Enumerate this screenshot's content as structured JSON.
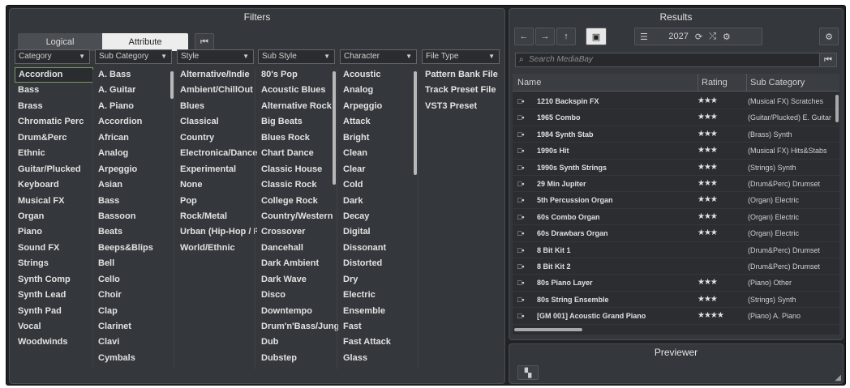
{
  "filters": {
    "title": "Filters",
    "mode_logical": "Logical",
    "mode_attribute": "Attribute",
    "reset_icon": "⏮",
    "columns": [
      {
        "header": "Category",
        "items": [
          "Accordion",
          "Bass",
          "Brass",
          "Chromatic Perc",
          "Drum&Perc",
          "Ethnic",
          "Guitar/Plucked",
          "Keyboard",
          "Musical FX",
          "Organ",
          "Piano",
          "Sound FX",
          "Strings",
          "Synth Comp",
          "Synth Lead",
          "Synth Pad",
          "Vocal",
          "Woodwinds"
        ]
      },
      {
        "header": "Sub Category",
        "items": [
          "A. Bass",
          "A. Guitar",
          "A. Piano",
          "Accordion",
          "African",
          "Analog",
          "Arpeggio",
          "Asian",
          "Bass",
          "Bassoon",
          "Beats",
          "Beeps&Blips",
          "Bell",
          "Cello",
          "Choir",
          "Clap",
          "Clarinet",
          "Clavi",
          "Cymbals"
        ]
      },
      {
        "header": "Style",
        "items": [
          "Alternative/Indie",
          "Ambient/ChillOut",
          "Blues",
          "Classical",
          "Country",
          "Electronica/Dance",
          "Experimental",
          "None",
          "Pop",
          "Rock/Metal",
          "Urban (Hip-Hop / R&B)",
          "World/Ethnic"
        ]
      },
      {
        "header": "Sub Style",
        "items": [
          "80's Pop",
          "Acoustic Blues",
          "Alternative Rock",
          "Big Beats",
          "Blues Rock",
          "Chart Dance",
          "Classic House",
          "Classic Rock",
          "College Rock",
          "Country/Western",
          "Crossover",
          "Dancehall",
          "Dark Ambient",
          "Dark Wave",
          "Disco",
          "Downtempo",
          "Drum'n'Bass/Jungle",
          "Dub",
          "Dubstep"
        ]
      },
      {
        "header": "Character",
        "items": [
          "Acoustic",
          "Analog",
          "Arpeggio",
          "Attack",
          "Bright",
          "Clean",
          "Clear",
          "Cold",
          "Dark",
          "Decay",
          "Digital",
          "Dissonant",
          "Distorted",
          "Dry",
          "Electric",
          "Ensemble",
          "Fast",
          "Fast Attack",
          "Glass"
        ]
      },
      {
        "header": "File Type",
        "items": [
          "Pattern Bank File",
          "Track Preset File",
          "VST3 Preset"
        ]
      }
    ],
    "selected_item": "Accordion"
  },
  "results": {
    "title": "Results",
    "count": "2027",
    "search_placeholder": "Search MediaBay",
    "columns": {
      "name": "Name",
      "rating": "Rating",
      "sub_category": "Sub Category"
    },
    "rows": [
      {
        "name": "1210 Backspin FX",
        "rating": "★★★",
        "sub": "(Musical FX) Scratches"
      },
      {
        "name": "1965 Combo",
        "rating": "★★★",
        "sub": "(Guitar/Plucked) E. Guitar"
      },
      {
        "name": "1984 Synth Stab",
        "rating": "★★★",
        "sub": "(Brass) Synth"
      },
      {
        "name": "1990s Hit",
        "rating": "★★★",
        "sub": "(Musical FX) Hits&Stabs"
      },
      {
        "name": "1990s Synth Strings",
        "rating": "★★★",
        "sub": "(Strings) Synth"
      },
      {
        "name": "29 Min Jupiter",
        "rating": "★★★",
        "sub": "(Drum&Perc) Drumset"
      },
      {
        "name": "5th Percussion Organ",
        "rating": "★★★",
        "sub": "(Organ) Electric"
      },
      {
        "name": "60s Combo Organ",
        "rating": "★★★",
        "sub": "(Organ) Electric"
      },
      {
        "name": "60s Drawbars Organ",
        "rating": "★★★",
        "sub": "(Organ) Electric"
      },
      {
        "name": "8 Bit Kit 1",
        "rating": "",
        "sub": "(Drum&Perc) Drumset"
      },
      {
        "name": "8 Bit Kit 2",
        "rating": "",
        "sub": "(Drum&Perc) Drumset"
      },
      {
        "name": "80s Piano Layer",
        "rating": "★★★",
        "sub": "(Piano) Other"
      },
      {
        "name": "80s String Ensemble",
        "rating": "★★★",
        "sub": "(Strings) Synth"
      },
      {
        "name": "[GM 001] Acoustic Grand Piano",
        "rating": "★★★★",
        "sub": "(Piano) A. Piano"
      }
    ]
  },
  "previewer": {
    "title": "Previewer"
  },
  "colors": {
    "panel": "#34373b",
    "background": "#202225",
    "selection": "#7a9a5a"
  }
}
